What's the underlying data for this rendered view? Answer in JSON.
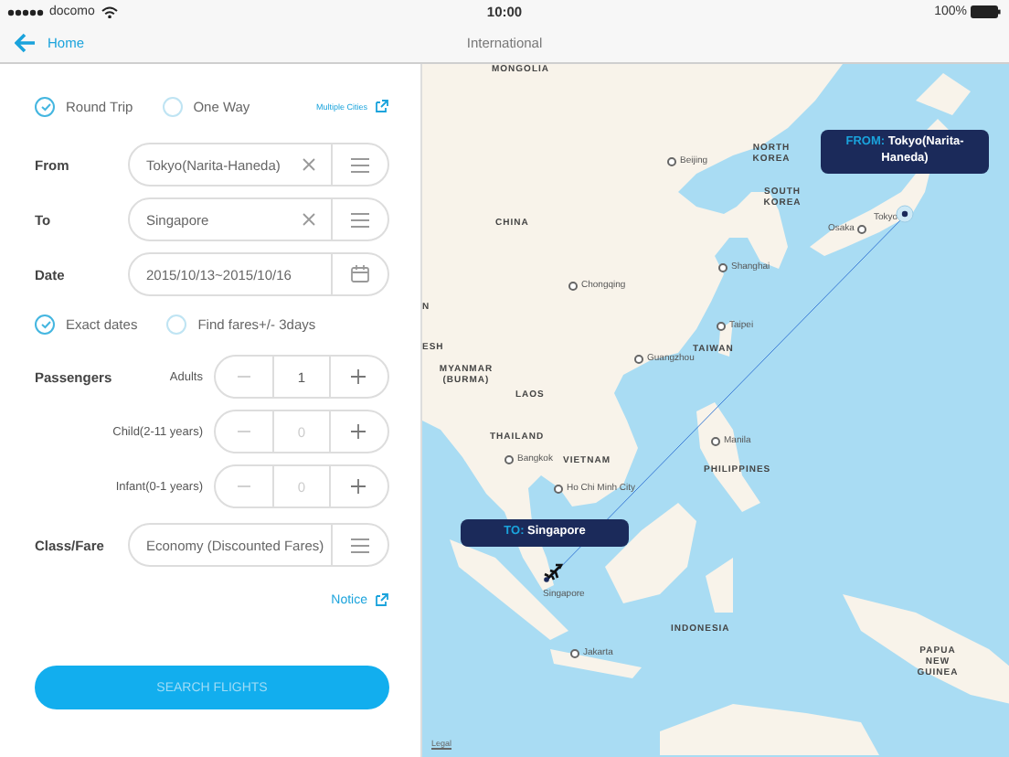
{
  "status_bar": {
    "carrier": "docomo",
    "time": "10:00",
    "battery": "100%"
  },
  "nav": {
    "back": "Home",
    "title": "International"
  },
  "trip_types": [
    {
      "label": "Round Trip",
      "selected": true
    },
    {
      "label": "One Way",
      "selected": false
    }
  ],
  "multiple_cities": "Multiple Cities",
  "fields": [
    {
      "label": "From",
      "value": "Tokyo(Narita-Haneda)",
      "kind": "clearable"
    },
    {
      "label": "To",
      "value": "Singapore",
      "kind": "clearable"
    },
    {
      "label": "Date",
      "value": "2015/10/13~2015/10/16",
      "kind": "date"
    }
  ],
  "date_options": [
    {
      "label": "Exact dates",
      "checked": true
    },
    {
      "label": "Find fares+/- 3days",
      "checked": false
    }
  ],
  "passengers": {
    "label": "Passengers",
    "rows": [
      {
        "label": "Adults",
        "value": "1",
        "zero": false
      },
      {
        "label": "Child(2-11 years)",
        "value": "0",
        "zero": true
      },
      {
        "label": "Infant(0-1 years)",
        "value": "0",
        "zero": true
      }
    ]
  },
  "class_fare": {
    "label": "Class/Fare",
    "value": "Economy (Discounted Fares)"
  },
  "notice": "Notice",
  "search_button": "SEARCH FLIGHTS",
  "map": {
    "labels": [
      {
        "text": "MONGOLIA",
        "kind": "country"
      },
      {
        "text": "Beijing",
        "kind": "city"
      },
      {
        "text": "NORTH KOREA",
        "kind": "country"
      },
      {
        "text": "SOUTH KOREA",
        "kind": "country"
      },
      {
        "text": "CHINA",
        "kind": "country"
      },
      {
        "text": "Osaka",
        "kind": "city"
      },
      {
        "text": "Tokyo",
        "kind": "city"
      },
      {
        "text": "Shanghai",
        "kind": "city"
      },
      {
        "text": "Chongqing",
        "kind": "city"
      },
      {
        "text": "Taipei",
        "kind": "city"
      },
      {
        "text": "TAIWAN",
        "kind": "country"
      },
      {
        "text": "Guangzhou",
        "kind": "city"
      },
      {
        "text": "N",
        "kind": "country"
      },
      {
        "text": "ESH",
        "kind": "country"
      },
      {
        "text": "MYANMAR (BURMA)",
        "kind": "country"
      },
      {
        "text": "LAOS",
        "kind": "country"
      },
      {
        "text": "THAILAND",
        "kind": "country"
      },
      {
        "text": "VIETNAM",
        "kind": "country"
      },
      {
        "text": "Bangkok",
        "kind": "city"
      },
      {
        "text": "Ho Chi Minh City",
        "kind": "city"
      },
      {
        "text": "Manila",
        "kind": "city"
      },
      {
        "text": "PHILIPPINES",
        "kind": "country"
      },
      {
        "text": "Singapore",
        "kind": "city"
      },
      {
        "text": "INDONESIA",
        "kind": "country"
      },
      {
        "text": "Jakarta",
        "kind": "city"
      },
      {
        "text": "PAPUA NEW GUINEA",
        "kind": "country"
      }
    ],
    "from_callout": {
      "prefix": "FROM:",
      "text": "Tokyo(Narita-Haneda)"
    },
    "to_callout": {
      "prefix": "TO:",
      "text": "Singapore"
    },
    "legal": "Legal"
  }
}
